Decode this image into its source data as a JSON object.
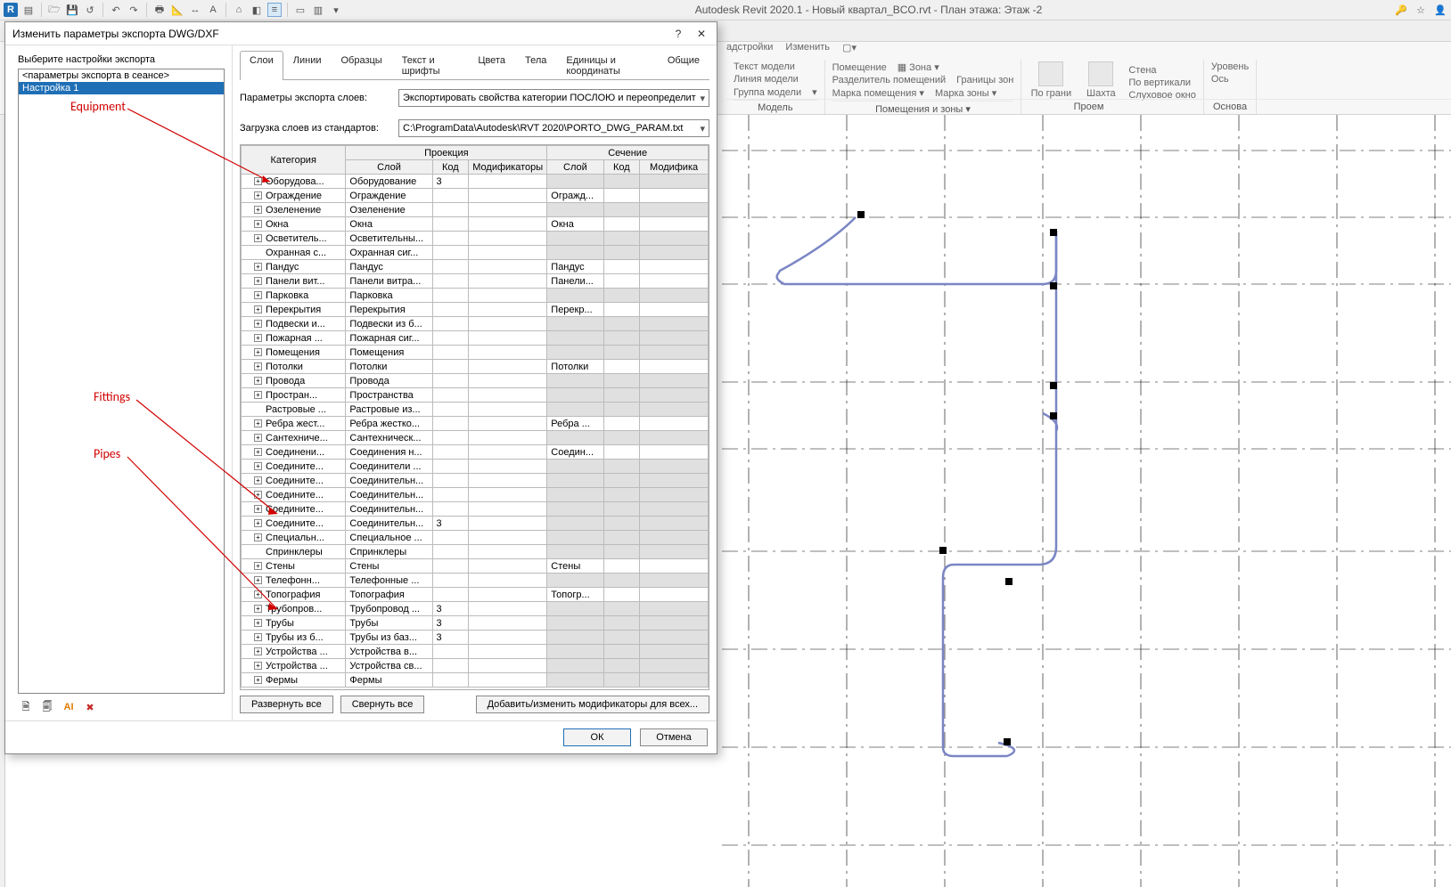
{
  "app": {
    "title": "Autodesk Revit 2020.1 - Новый квартал_BCO.rvt - План этажа: Этаж -2"
  },
  "ribbon": {
    "menu_addins": "адстройки",
    "menu_modify": "Изменить",
    "model": {
      "text": "Текст модели",
      "line": "Линия модели",
      "group": "Группа модели",
      "cap": "Модель"
    },
    "rooms": {
      "room": "Помещение",
      "sep": "Разделитель помещений",
      "tag": "Марка помещения",
      "zone": "Зона",
      "zborder": "Границы зон",
      "ztag": "Марка зоны",
      "cap": "Помещения и зоны ▾"
    },
    "opening": {
      "face": "По грани",
      "shaft": "Шахта",
      "wall": "Стена",
      "vert": "По вертикали",
      "dormer": "Слуховое окно",
      "cap": "Проем"
    },
    "datum": {
      "level": "Уровень",
      "grid": "Ось",
      "cap": "Основа"
    }
  },
  "dialog": {
    "title": "Изменить параметры экспорта DWG/DXF",
    "left_label": "Выберите настройки экспорта",
    "list": {
      "row0": "<параметры экспорта в сеансе>",
      "row1": "Настройка 1"
    },
    "tabs": {
      "layers": "Слои",
      "lines": "Линии",
      "patterns": "Образцы",
      "text": "Текст и шрифты",
      "colors": "Цвета",
      "solids": "Тела",
      "units": "Единицы и координаты",
      "general": "Общие"
    },
    "params_label": "Параметры экспорта слоев:",
    "params_value": "Экспортировать свойства категории ПОСЛОЮ и переопределит",
    "standards_label": "Загрузка слоев из стандартов:",
    "standards_value": "C:\\ProgramData\\Autodesk\\RVT 2020\\PORTO_DWG_PARAM.txt",
    "headers": {
      "cat": "Категория",
      "proj": "Проекция",
      "cut": "Сечение",
      "layer": "Слой",
      "id": "Код",
      "mod": "Модификаторы",
      "layer2": "Слой",
      "id2": "Код",
      "mod2": "Модифика"
    },
    "rows": [
      {
        "cat": "Оборудова...",
        "pl": "Оборудование",
        "pid": "3",
        "cl": "",
        "greyCut": true
      },
      {
        "cat": "Ограждение",
        "pl": "Ограждение",
        "pid": "",
        "cl": "Огражд..."
      },
      {
        "cat": "Озеленение",
        "pl": "Озеленение",
        "pid": "",
        "cl": "",
        "greyCut": true
      },
      {
        "cat": "Окна",
        "pl": "Окна",
        "pid": "",
        "cl": "Окна"
      },
      {
        "cat": "Осветитель...",
        "pl": "Осветительны...",
        "pid": "",
        "cl": "",
        "greyCut": true
      },
      {
        "cat": "Охранная с...",
        "pl": "Охранная сиг...",
        "pid": "",
        "cl": "",
        "greyCut": true,
        "noexp": true
      },
      {
        "cat": "Пандус",
        "pl": "Пандус",
        "pid": "",
        "cl": "Пандус"
      },
      {
        "cat": "Панели вит...",
        "pl": "Панели витра...",
        "pid": "",
        "cl": "Панели..."
      },
      {
        "cat": "Парковка",
        "pl": "Парковка",
        "pid": "",
        "cl": "",
        "greyCut": true
      },
      {
        "cat": "Перекрытия",
        "pl": "Перекрытия",
        "pid": "",
        "cl": "Перекр..."
      },
      {
        "cat": "Подвески и...",
        "pl": "Подвески из б...",
        "pid": "",
        "cl": "",
        "greyCut": true
      },
      {
        "cat": "Пожарная ...",
        "pl": "Пожарная сиг...",
        "pid": "",
        "cl": "",
        "greyCut": true
      },
      {
        "cat": "Помещения",
        "pl": "Помещения",
        "pid": "",
        "cl": "",
        "greyCut": true
      },
      {
        "cat": "Потолки",
        "pl": "Потолки",
        "pid": "",
        "cl": "Потолки"
      },
      {
        "cat": "Провода",
        "pl": "Провода",
        "pid": "",
        "cl": "",
        "greyCut": true
      },
      {
        "cat": "Простран...",
        "pl": "Пространства",
        "pid": "",
        "cl": "",
        "greyCut": true
      },
      {
        "cat": "Растровые ...",
        "pl": "Растровые из...",
        "pid": "",
        "cl": "",
        "greyCut": true,
        "noexp": true
      },
      {
        "cat": "Ребра жест...",
        "pl": "Ребра жестко...",
        "pid": "",
        "cl": "Ребра ..."
      },
      {
        "cat": "Сантехниче...",
        "pl": "Сантехническ...",
        "pid": "",
        "cl": "",
        "greyCut": true
      },
      {
        "cat": "Соединени...",
        "pl": "Соединения н...",
        "pid": "",
        "cl": "Соедин..."
      },
      {
        "cat": "Соедините...",
        "pl": "Соединители ...",
        "pid": "",
        "cl": "",
        "greyCut": true
      },
      {
        "cat": "Соедините...",
        "pl": "Соединительн...",
        "pid": "",
        "cl": "",
        "greyCut": true
      },
      {
        "cat": "Соедините...",
        "pl": "Соединительн...",
        "pid": "",
        "cl": "",
        "greyCut": true
      },
      {
        "cat": "Соедините...",
        "pl": "Соединительн...",
        "pid": "",
        "cl": "",
        "greyCut": true
      },
      {
        "cat": "Соедините...",
        "pl": "Соединительн...",
        "pid": "3",
        "cl": "",
        "greyCut": true
      },
      {
        "cat": "Специальн...",
        "pl": "Специальное ...",
        "pid": "",
        "cl": "",
        "greyCut": true
      },
      {
        "cat": "Спринклеры",
        "pl": "Спринклеры",
        "pid": "",
        "cl": "",
        "greyCut": true,
        "noexp": true
      },
      {
        "cat": "Стены",
        "pl": "Стены",
        "pid": "",
        "cl": "Стены"
      },
      {
        "cat": "Телефонн...",
        "pl": "Телефонные ...",
        "pid": "",
        "cl": "",
        "greyCut": true
      },
      {
        "cat": "Топография",
        "pl": "Топография",
        "pid": "",
        "cl": "Топогр..."
      },
      {
        "cat": "Трубопров...",
        "pl": "Трубопровод ...",
        "pid": "3",
        "cl": "",
        "greyCut": true
      },
      {
        "cat": "Трубы",
        "pl": "Трубы",
        "pid": "3",
        "cl": "",
        "greyCut": true
      },
      {
        "cat": "Трубы из б...",
        "pl": "Трубы из баз...",
        "pid": "3",
        "cl": "",
        "greyCut": true
      },
      {
        "cat": "Устройства ...",
        "pl": "Устройства в...",
        "pid": "",
        "cl": "",
        "greyCut": true
      },
      {
        "cat": "Устройства ...",
        "pl": "Устройства св...",
        "pid": "",
        "cl": "",
        "greyCut": true
      },
      {
        "cat": "Фермы",
        "pl": "Фермы",
        "pid": "",
        "cl": "",
        "greyCut": true
      }
    ],
    "expand_all": "Развернуть все",
    "collapse_all": "Свернуть все",
    "edit_mods": "Добавить/изменить модификаторы для всех...",
    "ok": "ОК",
    "cancel": "Отмена"
  },
  "callouts": {
    "equipment": "Equipment",
    "fittings": "Fittings",
    "pipes": "Pipes"
  }
}
